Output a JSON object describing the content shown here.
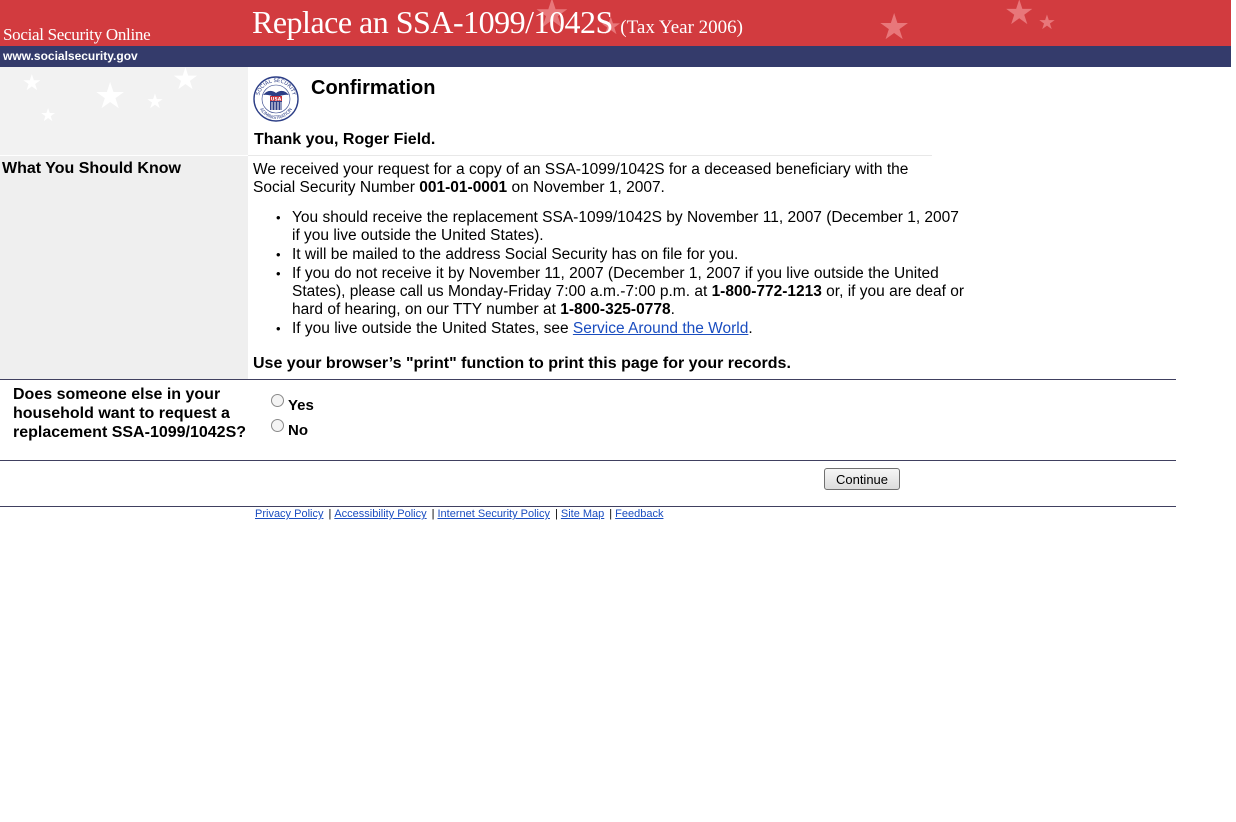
{
  "header": {
    "site_name": "Social Security Online",
    "title": "Replace an SSA-1099/1042S",
    "title_sub": "(Tax Year 2006)",
    "url": "www.socialsecurity.gov"
  },
  "seal": {
    "arc_top": "SOCIAL SECURITY",
    "arc_bottom": "ADMINISTRATION",
    "badge": "USA"
  },
  "confirmation": {
    "title": "Confirmation",
    "thanks": "Thank you, Roger Field."
  },
  "know": {
    "label": "What You Should Know",
    "intro_before": "We received your request for a copy of an SSA-1099/1042S for a deceased beneficiary with the Social Security Number ",
    "ssn": "001-01-0001",
    "intro_after": " on November 1, 2007.",
    "bullet1": "You should receive the replacement SSA-1099/1042S by November 11, 2007 (December 1, 2007 if you live outside the United States).",
    "bullet2": "It will be mailed to the address Social Security has on file for you.",
    "bullet3_a": "If you do not receive it by November 11, 2007 (December 1, 2007 if you live outside the United States), please call us Monday-Friday 7:00 a.m.-7:00 p.m. at ",
    "phone": "1-800-772-1213",
    "bullet3_b": " or, if you are deaf or hard of hearing, on our TTY number at ",
    "tty": "1-800-325-0778",
    "bullet3_c": ".",
    "bullet4_a": "If you live outside the United States, see ",
    "bullet4_link": "Service Around the World",
    "bullet4_b": ".",
    "print_note": "Use your browser’s \"print\" function to print this page for your records."
  },
  "question": {
    "text": "Does someone else in your household want to request a replacement SSA-1099/1042S?",
    "yes": "Yes",
    "no": "No"
  },
  "continue_label": "Continue",
  "footer": {
    "links": [
      "Privacy Policy",
      "Accessibility Policy",
      "Internet Security Policy",
      "Site Map",
      "Feedback"
    ],
    "separator": "|"
  },
  "colors": {
    "header_red": "#d23b3f",
    "header_blue": "#343b6b",
    "link": "#1a4dc0"
  }
}
